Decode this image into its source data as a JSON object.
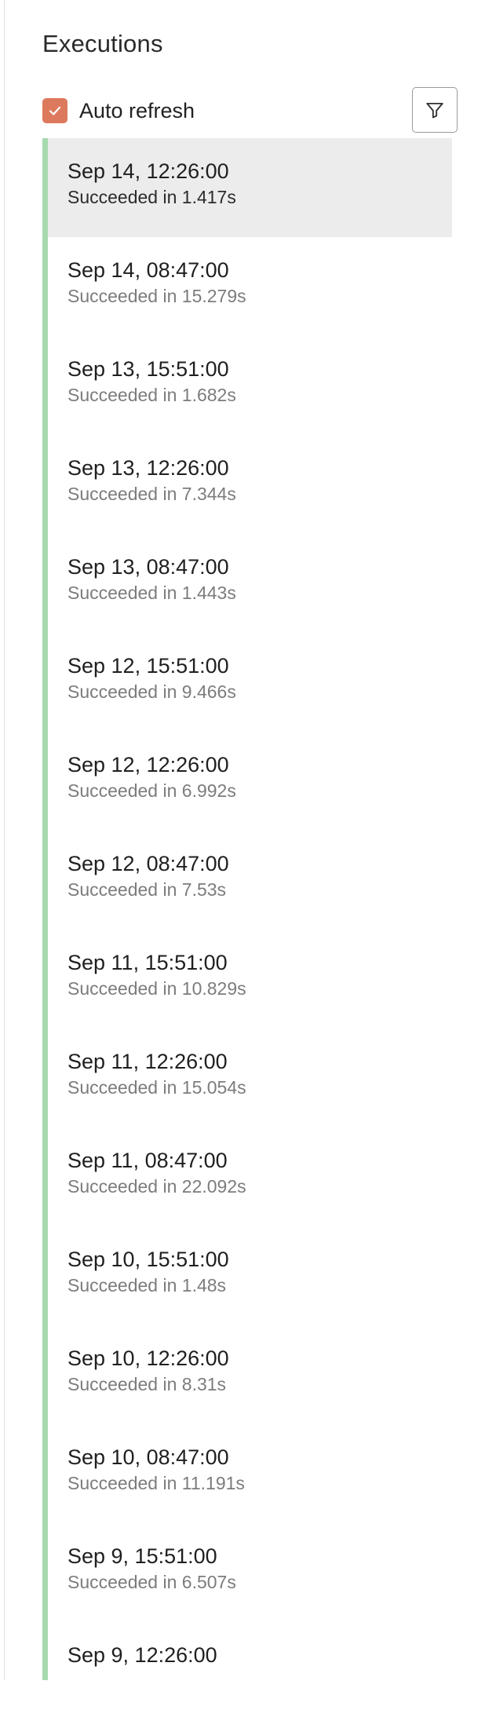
{
  "panel": {
    "title": "Executions",
    "auto_refresh": {
      "label": "Auto refresh",
      "checked": true,
      "color": "#dd7a5d"
    },
    "filter_button": {
      "icon": "filter-icon"
    }
  },
  "colors": {
    "timeline_success": "#a7d9b0",
    "selected_background": "#ececec"
  },
  "executions": [
    {
      "time": "Sep 14, 12:26:00",
      "status": "Succeeded in 1.417s",
      "selected": true
    },
    {
      "time": "Sep 14, 08:47:00",
      "status": "Succeeded in 15.279s",
      "selected": false
    },
    {
      "time": "Sep 13, 15:51:00",
      "status": "Succeeded in 1.682s",
      "selected": false
    },
    {
      "time": "Sep 13, 12:26:00",
      "status": "Succeeded in 7.344s",
      "selected": false
    },
    {
      "time": "Sep 13, 08:47:00",
      "status": "Succeeded in 1.443s",
      "selected": false
    },
    {
      "time": "Sep 12, 15:51:00",
      "status": "Succeeded in 9.466s",
      "selected": false
    },
    {
      "time": "Sep 12, 12:26:00",
      "status": "Succeeded in 6.992s",
      "selected": false
    },
    {
      "time": "Sep 12, 08:47:00",
      "status": "Succeeded in 7.53s",
      "selected": false
    },
    {
      "time": "Sep 11, 15:51:00",
      "status": "Succeeded in 10.829s",
      "selected": false
    },
    {
      "time": "Sep 11, 12:26:00",
      "status": "Succeeded in 15.054s",
      "selected": false
    },
    {
      "time": "Sep 11, 08:47:00",
      "status": "Succeeded in 22.092s",
      "selected": false
    },
    {
      "time": "Sep 10, 15:51:00",
      "status": "Succeeded in 1.48s",
      "selected": false
    },
    {
      "time": "Sep 10, 12:26:00",
      "status": "Succeeded in 8.31s",
      "selected": false
    },
    {
      "time": "Sep 10, 08:47:00",
      "status": "Succeeded in 11.191s",
      "selected": false
    },
    {
      "time": "Sep 9, 15:51:00",
      "status": "Succeeded in 6.507s",
      "selected": false
    },
    {
      "time": "Sep 9, 12:26:00",
      "status": "",
      "selected": false
    }
  ]
}
